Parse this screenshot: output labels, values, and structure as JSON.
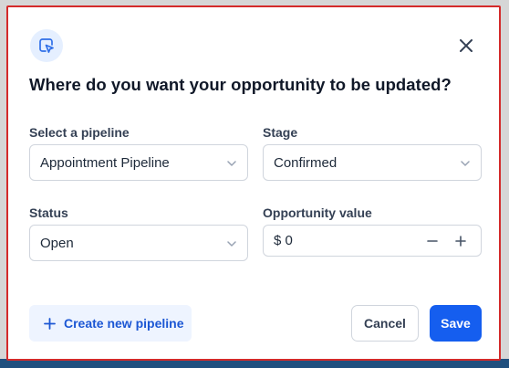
{
  "modal": {
    "title": "Where do you want your opportunity to be updated?",
    "header_icon": "cursor-select-icon",
    "close_icon": "close-icon"
  },
  "fields": {
    "pipeline": {
      "label": "Select a pipeline",
      "value": "Appointment Pipeline"
    },
    "stage": {
      "label": "Stage",
      "value": "Confirmed"
    },
    "status": {
      "label": "Status",
      "value": "Open"
    },
    "opportunity_value": {
      "label": "Opportunity value",
      "value": "$ 0"
    }
  },
  "footer": {
    "create_label": "Create new pipeline",
    "cancel_label": "Cancel",
    "save_label": "Save"
  },
  "colors": {
    "primary": "#155eef",
    "accent_bg": "#eef4ff",
    "modal_border": "#d42a2a",
    "text": "#101828"
  }
}
